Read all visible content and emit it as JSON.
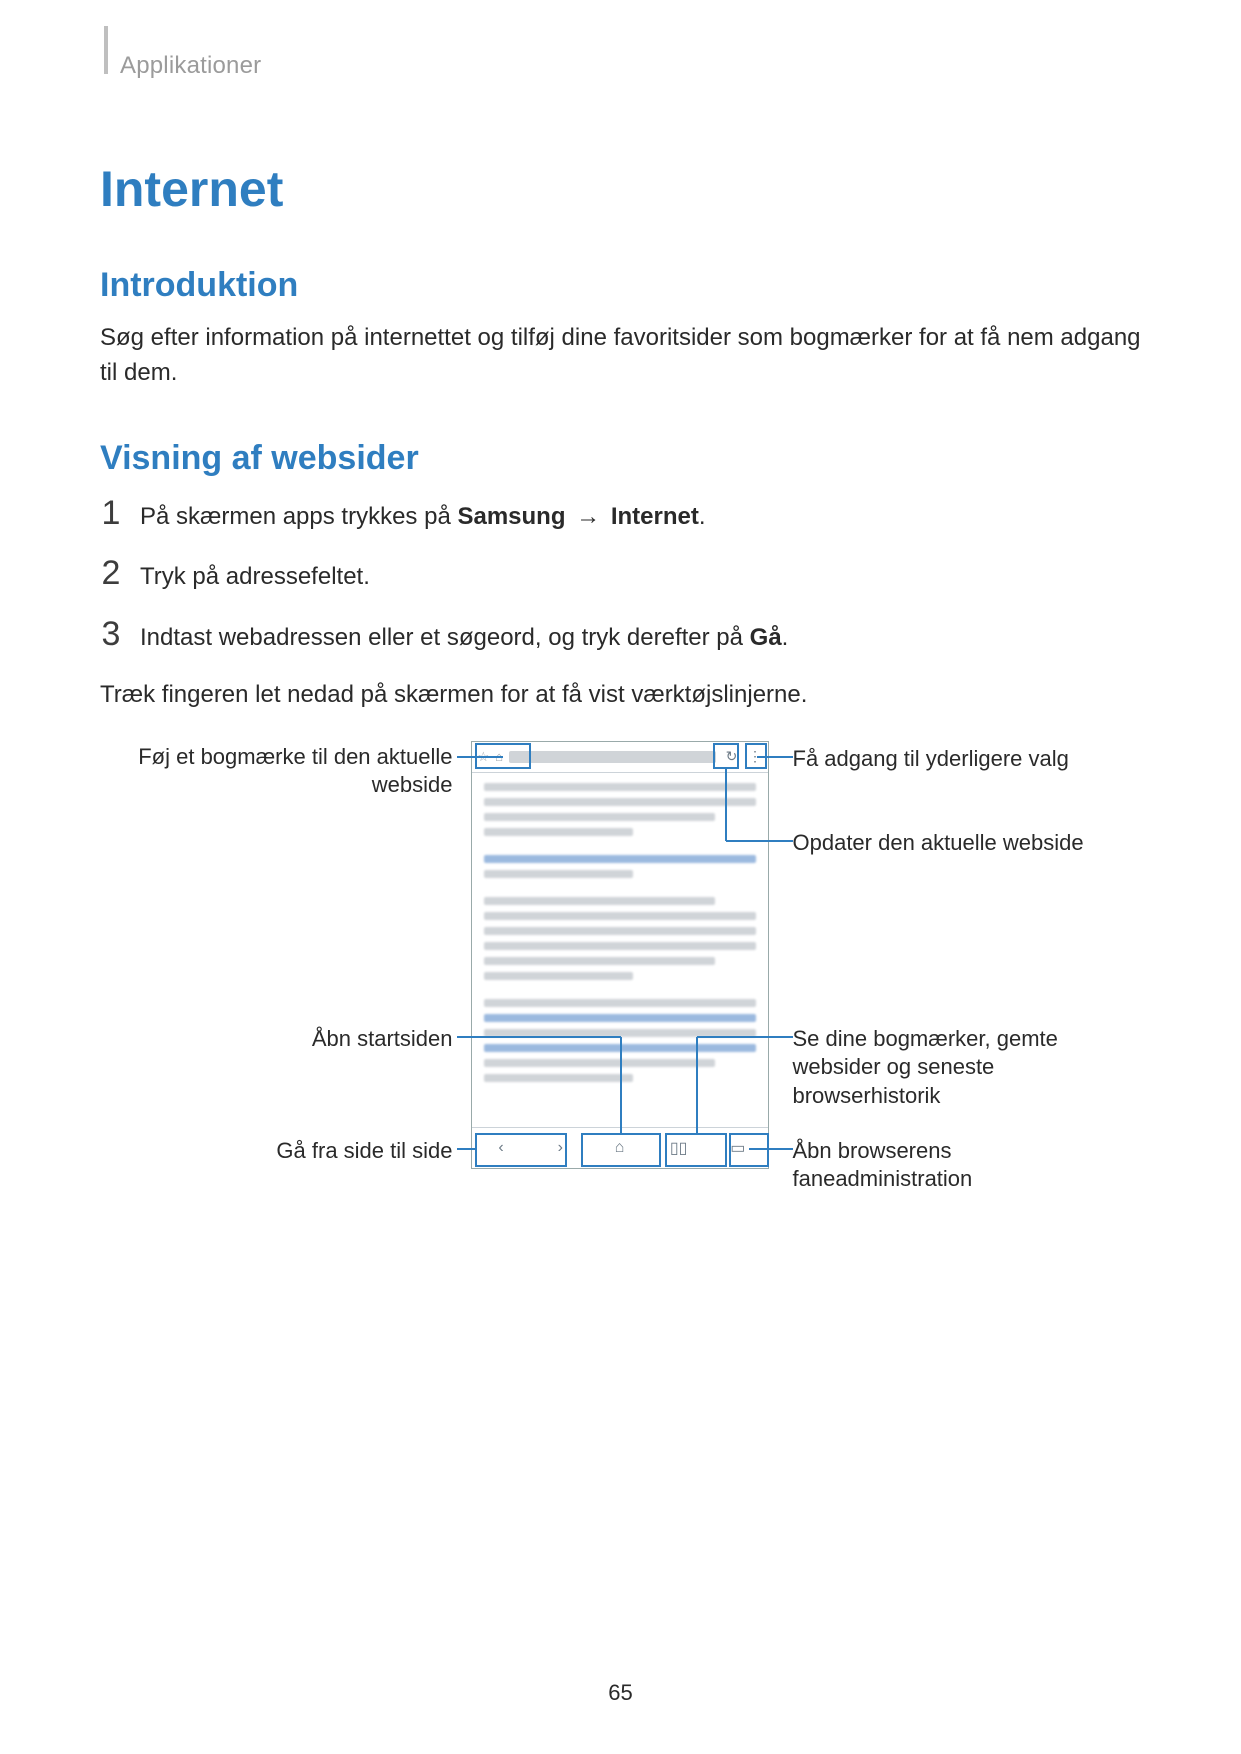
{
  "header": {
    "section_label": "Applikationer"
  },
  "title": "Internet",
  "intro": {
    "heading": "Introduktion",
    "body": "Søg efter information på internettet og tilføj dine favoritsider som bogmærker for at få nem adgang til dem."
  },
  "viewing": {
    "heading": "Visning af websider",
    "steps": [
      {
        "num": "1",
        "pre": "På skærmen apps trykkes på ",
        "bold1": "Samsung",
        "arrow": " → ",
        "bold2": "Internet",
        "post": "."
      },
      {
        "num": "2",
        "pre": "Tryk på adressefeltet.",
        "bold1": "",
        "arrow": "",
        "bold2": "",
        "post": ""
      },
      {
        "num": "3",
        "pre": "Indtast webadressen eller et søgeord, og tryk derefter på ",
        "bold1": "Gå",
        "arrow": "",
        "bold2": "",
        "post": "."
      }
    ],
    "tip": "Træk fingeren let nedad på skærmen for at få vist værktøjslinjerne."
  },
  "callouts": {
    "left": {
      "bookmark": "Føj et bogmærke til den aktuelle webside",
      "home": "Åbn startsiden",
      "nav": "Gå fra side til side"
    },
    "right": {
      "more": "Få adgang til yderligere valg",
      "refresh": "Opdater den aktuelle webside",
      "bookmarks": "Se dine bogmærker, gemte websider og seneste browserhistorik",
      "tabs": "Åbn browserens faneadministration"
    }
  },
  "page_number": "65"
}
